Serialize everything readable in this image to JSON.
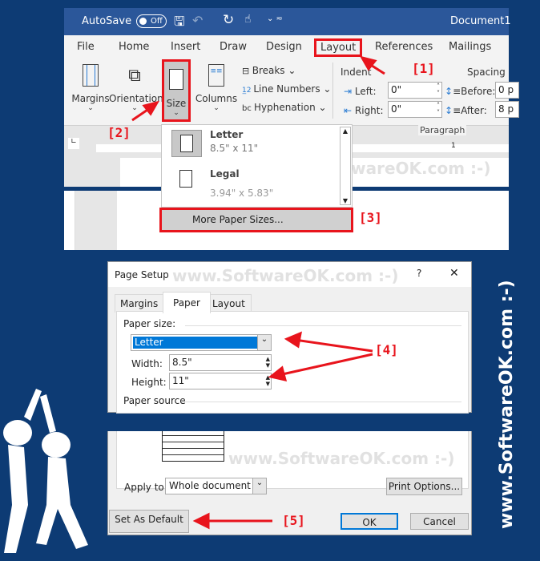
{
  "titlebar": {
    "autosave_label": "AutoSave",
    "autosave_state": "Off",
    "document_title": "Document1"
  },
  "tabs": [
    "File",
    "Home",
    "Insert",
    "Draw",
    "Design",
    "Layout",
    "References",
    "Mailings"
  ],
  "active_tab": "Layout",
  "ribbon": {
    "margins": "Margins",
    "orientation": "Orientation",
    "size": "Size",
    "columns": "Columns",
    "breaks": "Breaks",
    "line_numbers": "Line Numbers",
    "hyphenation": "Hyphenation",
    "indent_label": "Indent",
    "indent_left_label": "Left:",
    "indent_left_value": "0\"",
    "indent_right_label": "Right:",
    "indent_right_value": "0\"",
    "spacing_label": "Spacing",
    "before_label": "Before:",
    "before_value": "0 p",
    "after_label": "After:",
    "after_value": "8 p",
    "paragraph_group": "Paragraph"
  },
  "size_dropdown": {
    "items": [
      {
        "name": "Letter",
        "dims": "8.5\" x 11\""
      },
      {
        "name": "Legal",
        "dims": "3.94\" x 5.83\""
      }
    ],
    "more": "More Paper Sizes..."
  },
  "ruler_mark": "1",
  "annotations": [
    "[1]",
    "[2]",
    "[3]",
    "[4]",
    "[5]"
  ],
  "watermark": "www.SoftwareOK.com :-)",
  "dialog": {
    "title": "Page Setup",
    "help": "?",
    "close": "✕",
    "tabs": [
      "Margins",
      "Paper",
      "Layout"
    ],
    "active_tab": "Paper",
    "paper_size_label": "Paper size:",
    "paper_size_value": "Letter",
    "width_label": "Width:",
    "width_value": "8.5\"",
    "height_label": "Height:",
    "height_value": "11\"",
    "paper_source_label": "Paper source",
    "apply_to_label": "Apply to:",
    "apply_to_value": "Whole document",
    "print_options": "Print Options...",
    "set_default": "Set As Default",
    "ok": "OK",
    "cancel": "Cancel"
  },
  "colors": {
    "background": "#0d3b74",
    "word_blue": "#2b579a",
    "annotation_red": "#e8141c",
    "selection_blue": "#0078d7"
  }
}
